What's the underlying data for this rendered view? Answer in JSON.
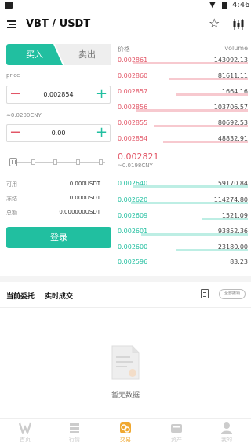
{
  "status_bar": {
    "time": "4:46"
  },
  "header": {
    "pair": "VBT / USDT"
  },
  "trade_tabs": {
    "buy": "买入",
    "sell": "卖出"
  },
  "form": {
    "price_label": "price",
    "price_value": "0.002854",
    "price_cny": "≈0.0200CNY",
    "amount_value": "0.00"
  },
  "balances": [
    {
      "label": "可用",
      "value": "0.000USDT"
    },
    {
      "label": "冻结",
      "value": "0.000USDT"
    },
    {
      "label": "总额",
      "value": "0.000000USDT"
    }
  ],
  "login_label": "登录",
  "orderbook": {
    "price_header": "价格",
    "volume_header": "volume",
    "asks": [
      {
        "price": "0.002861",
        "volume": "143092.13",
        "depth": 0.88
      },
      {
        "price": "0.002860",
        "volume": "81611.11",
        "depth": 0.6
      },
      {
        "price": "0.002857",
        "volume": "1664.16",
        "depth": 0.55
      },
      {
        "price": "0.002856",
        "volume": "103706.57",
        "depth": 0.86
      },
      {
        "price": "0.002855",
        "volume": "80692.53",
        "depth": 0.72
      },
      {
        "price": "0.002854",
        "volume": "48832.91",
        "depth": 0.65
      }
    ],
    "last_price": "0.002821",
    "last_cny": "≈0.0198CNY",
    "bids": [
      {
        "price": "0.002640",
        "volume": "59170.84",
        "depth": 0.88
      },
      {
        "price": "0.002620",
        "volume": "114274.80",
        "depth": 0.9
      },
      {
        "price": "0.002609",
        "volume": "1521.09",
        "depth": 0.35
      },
      {
        "price": "0.002601",
        "volume": "93852.36",
        "depth": 0.82
      },
      {
        "price": "0.002600",
        "volume": "23180.00",
        "depth": 0.55
      },
      {
        "price": "0.002596",
        "volume": "83.23",
        "depth": 0.0
      }
    ]
  },
  "orders": {
    "tab_current": "当前委托",
    "tab_deals": "实时成交",
    "cancel_all": "全部撤销",
    "empty_text": "暂无数据"
  },
  "nav": [
    {
      "label": "首页",
      "icon": "home-icon"
    },
    {
      "label": "行情",
      "icon": "market-icon"
    },
    {
      "label": "交易",
      "icon": "trade-icon",
      "active": true
    },
    {
      "label": "资产",
      "icon": "assets-icon"
    },
    {
      "label": "我的",
      "icon": "profile-icon"
    }
  ],
  "colors": {
    "buy": "#21bfa0",
    "sell": "#e25566",
    "active_nav": "#f0a830"
  }
}
